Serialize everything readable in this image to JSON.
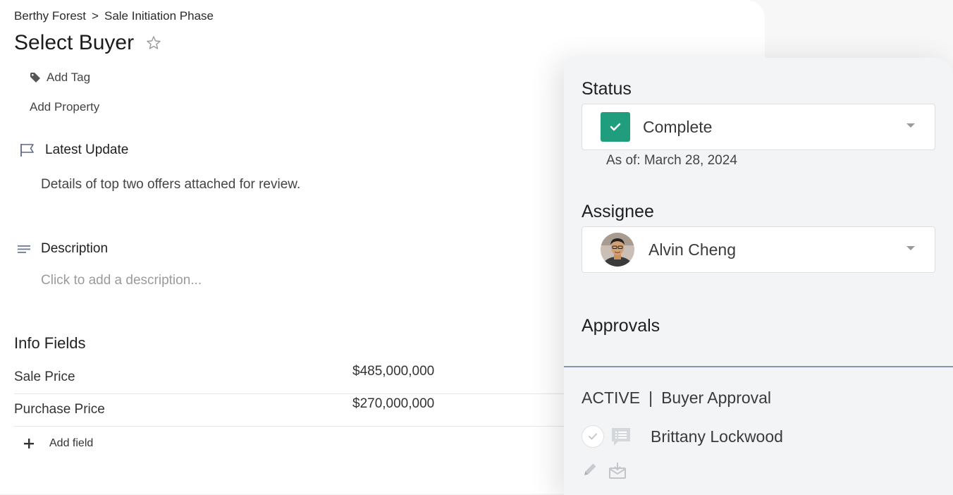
{
  "breadcrumb": {
    "parent": "Berthy Forest",
    "separator": ">",
    "current": "Sale Initiation Phase"
  },
  "page_title": "Select Buyer",
  "add_tag_label": "Add Tag",
  "add_property_label": "Add Property",
  "latest_update": {
    "heading": "Latest Update",
    "text": "Details of top two offers attached for review."
  },
  "description": {
    "heading": "Description",
    "placeholder": "Click to add a description..."
  },
  "info_fields": {
    "heading": "Info Fields",
    "rows": [
      {
        "label": "Sale Price",
        "value": "$485,000,000"
      },
      {
        "label": "Purchase Price",
        "value": "$270,000,000"
      }
    ],
    "add_label": "Add field"
  },
  "status": {
    "heading": "Status",
    "value": "Complete",
    "as_of": "As of: March 28, 2024",
    "color": "#1f9d7c"
  },
  "assignee": {
    "heading": "Assignee",
    "name": "Alvin Cheng"
  },
  "approvals": {
    "heading": "Approvals",
    "state": "ACTIVE",
    "separator": "|",
    "name": "Buyer Approval",
    "approver": "Brittany Lockwood"
  },
  "icons": [
    "star-icon",
    "tag-icon",
    "flag-icon",
    "lines-icon",
    "plus-icon",
    "check-icon",
    "chevron-down-icon",
    "comment-list-icon",
    "pencil-icon",
    "envelope-icon"
  ]
}
